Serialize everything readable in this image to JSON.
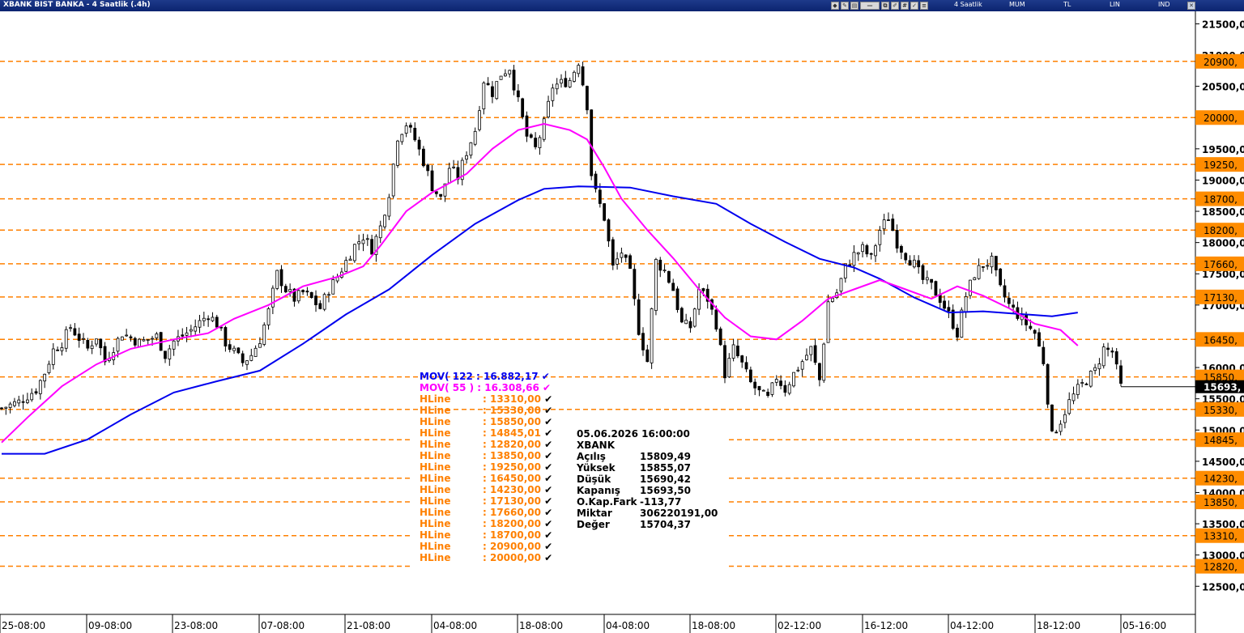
{
  "window": {
    "title": "XBANK BIST BANKA - 4 Saatlik (.4h)"
  },
  "toolbar": {
    "period": "4 Saatlik",
    "style": "MUM",
    "currency": "TL",
    "scale": "LIN",
    "mode": "IND"
  },
  "colors": {
    "ma122": "#0000ee",
    "ma55": "#ff00ff",
    "hline": "#ff8000",
    "candle": "#000000",
    "badge": "#ff8c00"
  },
  "chart_data": {
    "type": "candlestick",
    "symbol": "XBANK",
    "timeframe": "4h",
    "ylim": [
      12050,
      21700
    ],
    "y_ticks": [
      "21500,0",
      "21000,0",
      "20500,0",
      "20000,0",
      "19500,0",
      "19000,0",
      "18500,0",
      "18000,0",
      "17500,0",
      "17000,0",
      "16500,0",
      "16000,0",
      "15500,0",
      "15000,0",
      "14500,0",
      "14000,0",
      "13500,0",
      "13000,0",
      "12500,0"
    ],
    "y_tick_values": [
      21500,
      21000,
      20500,
      20000,
      19500,
      19000,
      18500,
      18000,
      17500,
      17000,
      16500,
      16000,
      15500,
      15000,
      14500,
      14000,
      13500,
      13000,
      12500
    ],
    "x_labels": [
      "25-08:00",
      "09-08:00",
      "23-08:00",
      "07-08:00",
      "21-08:00",
      "04-08:00",
      "18-08:00",
      "04-08:00",
      "18-08:00",
      "02-12:00",
      "16-12:00",
      "04-12:00",
      "18-12:00",
      "05-16:00"
    ],
    "hlines": [
      20900,
      20000,
      19250,
      18700,
      18200,
      17660,
      17130,
      16450,
      15850,
      15330,
      14845,
      14230,
      13850,
      13310,
      12820
    ],
    "hline_labels": [
      "20900,",
      "20000,",
      "19250,",
      "18700,",
      "18200,",
      "17660,",
      "17130,",
      "16450,",
      "15850,",
      "15330,",
      "14845,",
      "14230,",
      "13850,",
      "13310,",
      "12820,"
    ],
    "last_price_label": "15693,",
    "last_price": 15693.5,
    "close_path": [
      [
        0,
        15350
      ],
      [
        4,
        15450
      ],
      [
        8,
        15650
      ],
      [
        10,
        15920
      ],
      [
        12,
        16280
      ],
      [
        14,
        16400
      ],
      [
        16,
        16650
      ],
      [
        20,
        16300
      ],
      [
        22,
        16500
      ],
      [
        24,
        16100
      ],
      [
        28,
        16550
      ],
      [
        32,
        16400
      ],
      [
        36,
        16500
      ],
      [
        38,
        16200
      ],
      [
        40,
        16420
      ],
      [
        44,
        16600
      ],
      [
        48,
        16850
      ],
      [
        50,
        16700
      ],
      [
        52,
        16400
      ],
      [
        54,
        16250
      ],
      [
        56,
        16080
      ],
      [
        58,
        16200
      ],
      [
        60,
        16450
      ],
      [
        62,
        16900
      ],
      [
        64,
        17500
      ],
      [
        66,
        17250
      ],
      [
        68,
        17100
      ],
      [
        70,
        17200
      ],
      [
        72,
        17100
      ],
      [
        74,
        16950
      ],
      [
        76,
        17250
      ],
      [
        78,
        17450
      ],
      [
        80,
        17700
      ],
      [
        82,
        17950
      ],
      [
        84,
        18100
      ],
      [
        86,
        17900
      ],
      [
        88,
        18250
      ],
      [
        90,
        18800
      ],
      [
        92,
        19700
      ],
      [
        94,
        19900
      ],
      [
        96,
        19650
      ],
      [
        98,
        19300
      ],
      [
        100,
        18900
      ],
      [
        102,
        18700
      ],
      [
        104,
        19200
      ],
      [
        106,
        19050
      ],
      [
        108,
        19450
      ],
      [
        110,
        19800
      ],
      [
        112,
        20600
      ],
      [
        114,
        20400
      ],
      [
        116,
        20700
      ],
      [
        118,
        20800
      ],
      [
        120,
        20250
      ],
      [
        122,
        19700
      ],
      [
        124,
        19500
      ],
      [
        126,
        19900
      ],
      [
        128,
        20500
      ],
      [
        130,
        20550
      ],
      [
        132,
        20600
      ],
      [
        134,
        20900
      ],
      [
        136,
        20200
      ],
      [
        137,
        19100
      ],
      [
        138,
        18800
      ],
      [
        140,
        18400
      ],
      [
        142,
        17600
      ],
      [
        144,
        17850
      ],
      [
        146,
        17500
      ],
      [
        148,
        16600
      ],
      [
        150,
        16100
      ],
      [
        152,
        17700
      ],
      [
        154,
        17550
      ],
      [
        156,
        17250
      ],
      [
        158,
        16700
      ],
      [
        160,
        16650
      ],
      [
        162,
        17250
      ],
      [
        164,
        17100
      ],
      [
        166,
        16700
      ],
      [
        168,
        15900
      ],
      [
        170,
        16300
      ],
      [
        172,
        16050
      ],
      [
        174,
        15750
      ],
      [
        176,
        15600
      ],
      [
        178,
        15500
      ],
      [
        180,
        15850
      ],
      [
        182,
        15650
      ],
      [
        184,
        15900
      ],
      [
        186,
        16100
      ],
      [
        188,
        16300
      ],
      [
        190,
        15800
      ],
      [
        192,
        17050
      ],
      [
        194,
        17200
      ],
      [
        196,
        17600
      ],
      [
        198,
        17800
      ],
      [
        200,
        17900
      ],
      [
        202,
        17750
      ],
      [
        204,
        18200
      ],
      [
        206,
        18400
      ],
      [
        208,
        18000
      ],
      [
        210,
        17800
      ],
      [
        212,
        17650
      ],
      [
        214,
        17400
      ],
      [
        216,
        17300
      ],
      [
        218,
        17100
      ],
      [
        220,
        16850
      ],
      [
        222,
        16550
      ],
      [
        224,
        17150
      ],
      [
        226,
        17500
      ],
      [
        228,
        17650
      ],
      [
        230,
        17700
      ],
      [
        232,
        17250
      ],
      [
        234,
        17000
      ],
      [
        236,
        16850
      ],
      [
        238,
        16700
      ],
      [
        240,
        16550
      ],
      [
        242,
        16100
      ],
      [
        244,
        14900
      ],
      [
        246,
        15150
      ],
      [
        248,
        15450
      ],
      [
        250,
        15650
      ],
      [
        252,
        15800
      ],
      [
        254,
        15950
      ],
      [
        256,
        16300
      ],
      [
        258,
        16250
      ],
      [
        260,
        15694
      ]
    ],
    "series": [
      {
        "name": "MOV( 122 : 16.882,17",
        "values": [
          [
            0,
            14620
          ],
          [
            10,
            14620
          ],
          [
            20,
            14850
          ],
          [
            30,
            15250
          ],
          [
            40,
            15600
          ],
          [
            50,
            15780
          ],
          [
            60,
            15950
          ],
          [
            70,
            16380
          ],
          [
            80,
            16850
          ],
          [
            90,
            17250
          ],
          [
            100,
            17800
          ],
          [
            110,
            18300
          ],
          [
            120,
            18680
          ],
          [
            126,
            18860
          ],
          [
            134,
            18900
          ],
          [
            146,
            18880
          ],
          [
            156,
            18740
          ],
          [
            166,
            18620
          ],
          [
            174,
            18300
          ],
          [
            182,
            18010
          ],
          [
            190,
            17740
          ],
          [
            198,
            17600
          ],
          [
            204,
            17420
          ],
          [
            212,
            17120
          ],
          [
            220,
            16880
          ],
          [
            228,
            16900
          ],
          [
            236,
            16860
          ],
          [
            244,
            16820
          ],
          [
            250,
            16880
          ]
        ]
      },
      {
        "name": "MOV( 55 ) : 16.308,66",
        "values": [
          [
            0,
            14800
          ],
          [
            6,
            15200
          ],
          [
            14,
            15700
          ],
          [
            22,
            16050
          ],
          [
            30,
            16300
          ],
          [
            40,
            16450
          ],
          [
            48,
            16550
          ],
          [
            54,
            16780
          ],
          [
            62,
            17000
          ],
          [
            70,
            17300
          ],
          [
            78,
            17450
          ],
          [
            84,
            17620
          ],
          [
            88,
            17950
          ],
          [
            94,
            18500
          ],
          [
            100,
            18800
          ],
          [
            108,
            19100
          ],
          [
            114,
            19500
          ],
          [
            120,
            19800
          ],
          [
            126,
            19900
          ],
          [
            132,
            19800
          ],
          [
            136,
            19650
          ],
          [
            140,
            19200
          ],
          [
            144,
            18700
          ],
          [
            150,
            18200
          ],
          [
            156,
            17750
          ],
          [
            162,
            17250
          ],
          [
            168,
            16800
          ],
          [
            174,
            16500
          ],
          [
            180,
            16450
          ],
          [
            186,
            16750
          ],
          [
            192,
            17100
          ],
          [
            198,
            17250
          ],
          [
            204,
            17400
          ],
          [
            210,
            17250
          ],
          [
            216,
            17100
          ],
          [
            222,
            17300
          ],
          [
            228,
            17150
          ],
          [
            234,
            16950
          ],
          [
            240,
            16700
          ],
          [
            246,
            16600
          ],
          [
            250,
            16350
          ]
        ]
      }
    ],
    "legend": {
      "ma122": "MOV( 122 : 16.882,17",
      "ma55": "MOV( 55 ) : 16.308,66",
      "hline_items": [
        {
          "name": "HLine",
          "value": ": 13310,00"
        },
        {
          "name": "HLine",
          "value": ": 15330,00"
        },
        {
          "name": "HLine",
          "value": ": 15850,00"
        },
        {
          "name": "HLine",
          "value": ": 14845,01"
        },
        {
          "name": "HLine",
          "value": ": 12820,00"
        },
        {
          "name": "HLine",
          "value": ": 13850,00"
        },
        {
          "name": "HLine",
          "value": ": 19250,00"
        },
        {
          "name": "HLine",
          "value": ": 16450,00"
        },
        {
          "name": "HLine",
          "value": ": 14230,00"
        },
        {
          "name": "HLine",
          "value": ": 17130,00"
        },
        {
          "name": "HLine",
          "value": ": 17660,00"
        },
        {
          "name": "HLine",
          "value": ": 18200,00"
        },
        {
          "name": "HLine",
          "value": ": 18700,00"
        },
        {
          "name": "HLine",
          "value": ": 20900,00"
        },
        {
          "name": "HLine",
          "value": ": 20000,00"
        }
      ]
    }
  },
  "info": {
    "datetime": "05.06.2026  16:00:00",
    "symbol": "XBANK",
    "rows": [
      {
        "k": "Açılış",
        "v": "15809,49"
      },
      {
        "k": "Yüksek",
        "v": "15855,07"
      },
      {
        "k": "Düşük",
        "v": "15690,42"
      },
      {
        "k": "Kapanış",
        "v": "15693,50"
      },
      {
        "k": "O.Kap.Fark",
        "v": "-113,77"
      },
      {
        "k": "Miktar",
        "v": "306220191,00"
      },
      {
        "k": "Değer",
        "v": "15704,37"
      }
    ]
  }
}
